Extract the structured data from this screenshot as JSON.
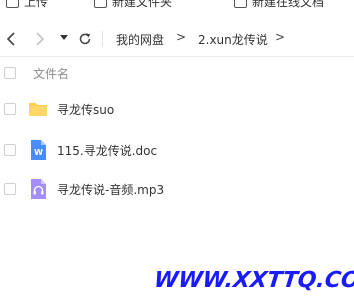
{
  "toolbar": {
    "items": [
      {
        "label": "上传"
      },
      {
        "label": "新建文件夹"
      },
      {
        "label": "新建在线文档"
      }
    ]
  },
  "nav": {
    "breadcrumbs": [
      "我的网盘",
      "2.xun龙传说"
    ]
  },
  "list": {
    "column_header": "文件名",
    "files": [
      {
        "name": "寻龙传suo",
        "icon": "folder-icon"
      },
      {
        "name": "115.寻龙传说.doc",
        "icon": "word-doc-icon"
      },
      {
        "name": "寻龙传说-音频.mp3",
        "icon": "audio-file-icon"
      }
    ]
  },
  "colors": {
    "folder": "#ffcc4d",
    "word_doc": "#4a8cff",
    "audio": "#a58cff",
    "watermark": "#1a1aff"
  },
  "watermark": "WWW.XXTTQ.COM"
}
